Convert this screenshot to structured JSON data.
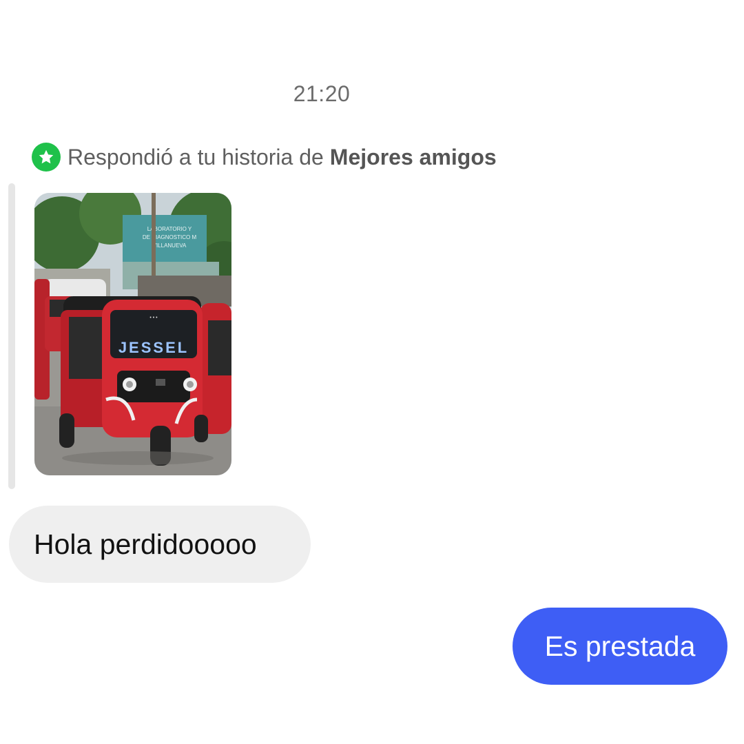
{
  "thread": {
    "timestamp": "21:20",
    "reply_note": {
      "icon": "star-icon",
      "prefix": "Respondió a tu historia de",
      "audience": "Mejores amigos",
      "badge_color": "#1fc14a"
    },
    "story_image": {
      "content": "photo of red mototaxis on a street",
      "sign_lines": [
        "LABORATORIO Y",
        "DE DIAGNOSTICO M",
        "VILLANUEVA"
      ],
      "windshield_text": "JESSEL"
    },
    "messages": [
      {
        "direction": "incoming",
        "text": "Hola perdidooooo"
      },
      {
        "direction": "outgoing",
        "text": "Es prestada",
        "color": "#3e5ef5"
      }
    ]
  }
}
